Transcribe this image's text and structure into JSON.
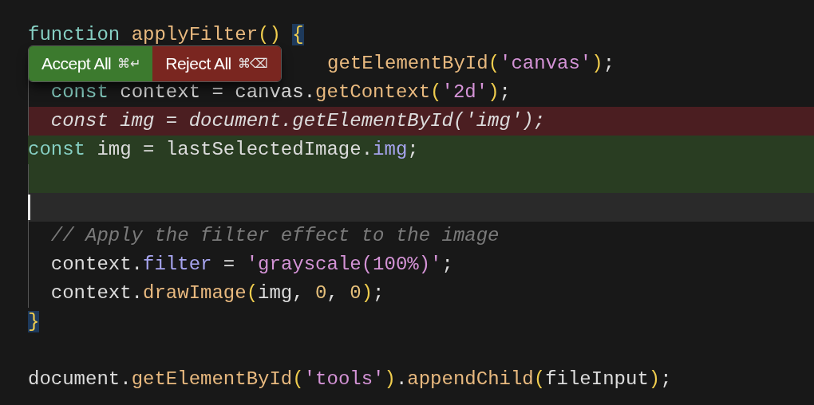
{
  "toolbar": {
    "buttons": [
      {
        "kind": "accept",
        "label": "Accept All",
        "shortcut": "⌘↵"
      },
      {
        "kind": "reject",
        "label": "Reject All",
        "shortcut": "⌘⌫"
      }
    ]
  },
  "lines": [
    {
      "kind": "normal",
      "guide": false,
      "tokens": [
        {
          "kind": "keyword",
          "s": "function "
        },
        {
          "kind": "function",
          "s": "applyFilter"
        },
        {
          "kind": "brace",
          "s": "() "
        },
        {
          "kind": "match",
          "s": "{"
        }
      ]
    },
    {
      "kind": "covered",
      "guide": true,
      "tokens": [
        {
          "kind": "function",
          "s": "getElementById"
        },
        {
          "kind": "brace",
          "s": "("
        },
        {
          "kind": "string",
          "s": "'canvas'"
        },
        {
          "kind": "brace",
          "s": ")"
        },
        {
          "kind": "plain",
          "s": ";"
        }
      ]
    },
    {
      "kind": "normal",
      "guide": true,
      "tokens": [
        {
          "kind": "keyword",
          "s": "  const"
        },
        {
          "kind": "plain",
          "s": " context = canvas."
        },
        {
          "kind": "function",
          "s": "getContext"
        },
        {
          "kind": "brace",
          "s": "("
        },
        {
          "kind": "string",
          "s": "'2d'"
        },
        {
          "kind": "brace",
          "s": ")"
        },
        {
          "kind": "plain",
          "s": ";"
        }
      ]
    },
    {
      "kind": "deleted",
      "guide": true,
      "tokens": [
        {
          "kind": "plain",
          "s": "  const img = document.getElementById('img');"
        }
      ]
    },
    {
      "kind": "added",
      "guide": false,
      "tokens": [
        {
          "kind": "keyword",
          "s": "const"
        },
        {
          "kind": "plain",
          "s": " img = lastSelectedImage."
        },
        {
          "kind": "property",
          "s": "img"
        },
        {
          "kind": "plain",
          "s": ";"
        }
      ]
    },
    {
      "kind": "added",
      "guide": true
    },
    {
      "kind": "current",
      "guide": true
    },
    {
      "kind": "normal",
      "guide": true,
      "tokens": [
        {
          "kind": "comment",
          "s": "  // Apply the filter effect to the image"
        }
      ]
    },
    {
      "kind": "normal",
      "guide": true,
      "tokens": [
        {
          "kind": "plain",
          "s": "  context."
        },
        {
          "kind": "property",
          "s": "filter"
        },
        {
          "kind": "plain",
          "s": " = "
        },
        {
          "kind": "string",
          "s": "'grayscale(100%)'"
        },
        {
          "kind": "plain",
          "s": ";"
        }
      ]
    },
    {
      "kind": "normal",
      "guide": true,
      "tokens": [
        {
          "kind": "plain",
          "s": "  context."
        },
        {
          "kind": "function",
          "s": "drawImage"
        },
        {
          "kind": "brace",
          "s": "("
        },
        {
          "kind": "plain",
          "s": "img, "
        },
        {
          "kind": "number",
          "s": "0"
        },
        {
          "kind": "plain",
          "s": ", "
        },
        {
          "kind": "number",
          "s": "0"
        },
        {
          "kind": "brace",
          "s": ")"
        },
        {
          "kind": "plain",
          "s": ";"
        }
      ]
    },
    {
      "kind": "normal",
      "guide": false,
      "tokens": [
        {
          "kind": "match",
          "s": "}"
        }
      ]
    },
    {
      "kind": "normal",
      "guide": false
    },
    {
      "kind": "normal",
      "guide": false,
      "tokens": [
        {
          "kind": "plain",
          "s": "document."
        },
        {
          "kind": "function",
          "s": "getElementById"
        },
        {
          "kind": "brace",
          "s": "("
        },
        {
          "kind": "string",
          "s": "'tools'"
        },
        {
          "kind": "brace",
          "s": ")"
        },
        {
          "kind": "plain",
          "s": "."
        },
        {
          "kind": "function",
          "s": "appendChild"
        },
        {
          "kind": "brace",
          "s": "("
        },
        {
          "kind": "plain",
          "s": "fileInput"
        },
        {
          "kind": "brace",
          "s": ")"
        },
        {
          "kind": "plain",
          "s": ";"
        }
      ]
    }
  ]
}
